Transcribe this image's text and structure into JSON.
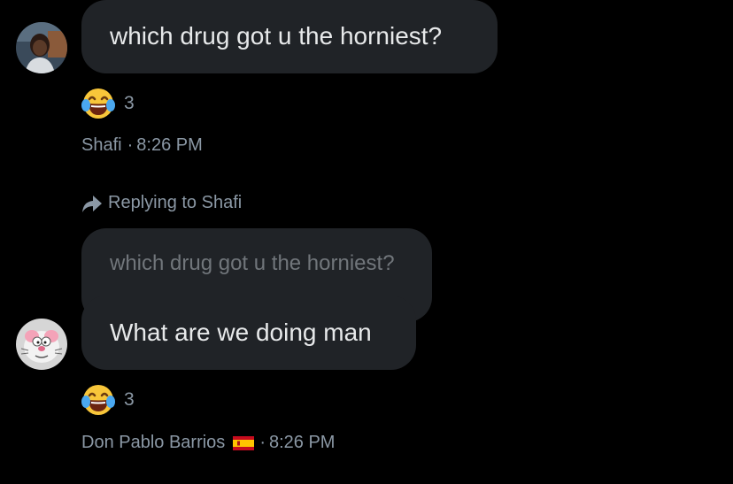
{
  "messages": [
    {
      "text": "which drug got u the horniest?",
      "reaction": {
        "emoji": "laughing-tears-emoji",
        "count": "3"
      },
      "sender": "Shafi",
      "separator": "·",
      "time": "8:26 PM"
    },
    {
      "reply_label": "Replying to Shafi",
      "quoted_text": "which drug got u the horniest?",
      "text": "What are we doing man",
      "reaction": {
        "emoji": "laughing-tears-emoji",
        "count": "3"
      },
      "sender": "Don Pablo Barrios",
      "flag": "spain-flag",
      "separator": "·",
      "time": "8:26 PM"
    }
  ],
  "colors": {
    "background": "#000000",
    "bubble": "#202327",
    "text": "#e7e9ea",
    "muted": "#8b98a5",
    "quoted_text": "#71767b"
  }
}
